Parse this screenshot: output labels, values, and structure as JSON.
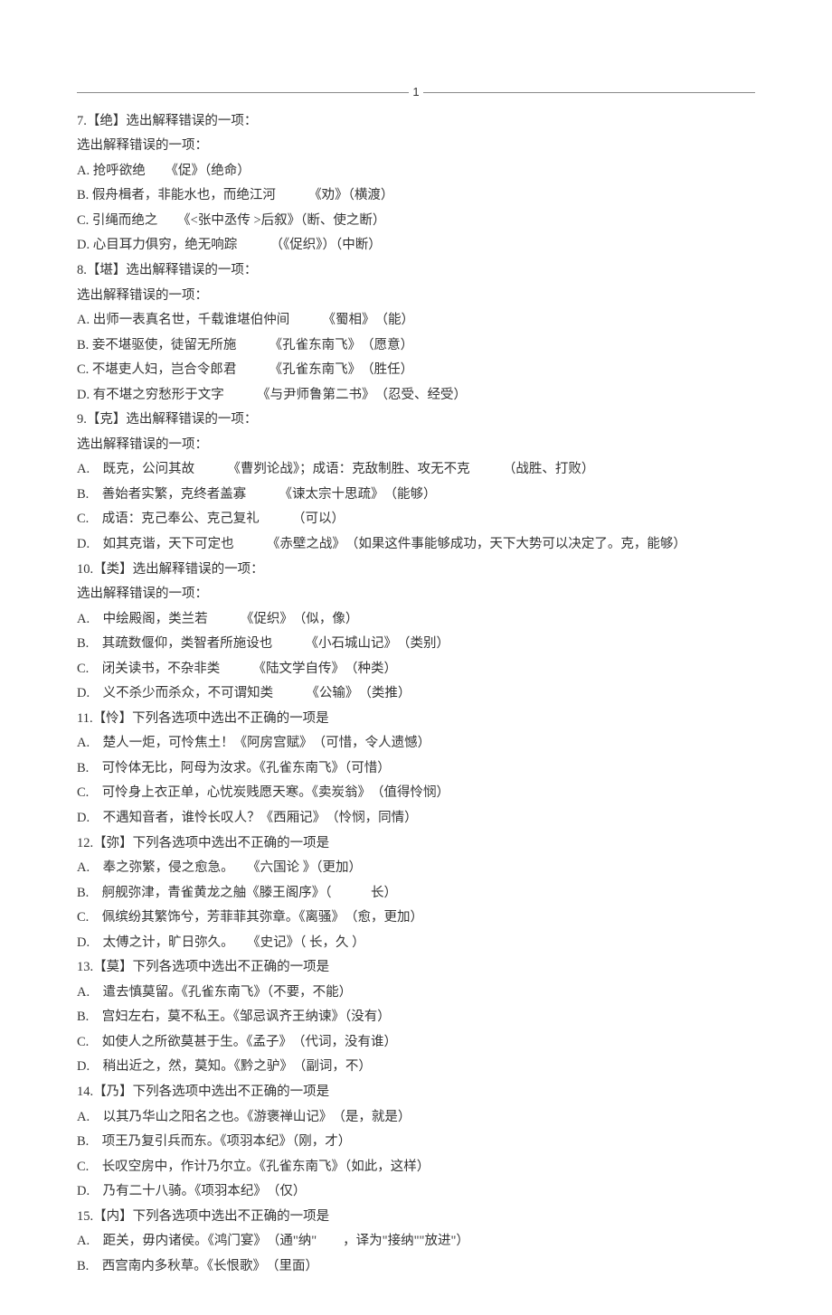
{
  "page_number": "1",
  "questions": [
    {
      "header": "7.【绝】选出解释错误的一项：",
      "prompt": "选出解释错误的一项：",
      "opts": [
        "A. 抢呼欲绝　　《促》（绝命）",
        "B. 假舟楫者，非能水也，而绝江河　　　《劝》（横渡）",
        "C. 引绳而绝之　　《<张中丞传 >后叙》（断、使之断）",
        "D. 心目耳力俱穷，绝无响踪　　　（《促织》）（中断）"
      ]
    },
    {
      "header": "8.【堪】选出解释错误的一项：",
      "prompt": "选出解释错误的一项：",
      "opts": [
        "A. 出师一表真名世，千载谁堪伯仲间　　　《蜀相》　（能）",
        "B. 妾不堪驱使，徒留无所施　　　《孔雀东南飞》　（愿意）",
        "C. 不堪吏人妇，岂合令郎君　　　《孔雀东南飞》　（胜任）",
        "D. 有不堪之穷愁形于文字　　　《与尹师鲁第二书》　（忍受、经受）"
      ]
    },
    {
      "header": "9.【克】选出解释错误的一项：",
      "prompt": "选出解释错误的一项：",
      "opts": [
        "A.　既克，公问其故　　　《曹刿论战》；成语：克敌制胜、攻无不克　　　（战胜、打败）",
        "B.　善始者实繁，克终者盖寡　　　《谏太宗十思疏》　（能够）",
        "C.　成语：克己奉公、克己复礼　　　（可以）",
        "D.　如其克谐，天下可定也　　　《赤壁之战》　（如果这件事能够成功，天下大势可以决定了。克，能够）"
      ]
    },
    {
      "header": "10.【类】选出解释错误的一项：",
      "prompt": "选出解释错误的一项：",
      "opts": [
        "A.　中绘殿阁，类兰若　　　《促织》　（似，像）",
        "B.　其疏数偃仰，类智者所施设也　　　《小石城山记》　（类别）",
        "C.　闭关读书，不杂非类　　　《陆文学自传》　（种类）",
        "D.　义不杀少而杀众，不可谓知类　　　《公输》　（类推）"
      ]
    },
    {
      "header": "11.【怜】下列各选项中选出不正确的一项是",
      "prompt": null,
      "opts": [
        "A.　楚人一炬，可怜焦土！《阿房宫赋》　（可惜，令人遗憾）",
        "B.　可怜体无比，阿母为汝求。《孔雀东南飞》（可惜）",
        "C.　可怜身上衣正单，心忧炭贱愿天寒。《卖炭翁》　（值得怜悯）",
        "D.　不遇知音者，谁怜长叹人？《西厢记》　（怜悯，同情）"
      ]
    },
    {
      "header": "12.【弥】下列各选项中选出不正确的一项是",
      "prompt": null,
      "opts": [
        "A.　奉之弥繁，侵之愈急。　　《六国论 》（更加）",
        "B.　舸舰弥津，青雀黄龙之舳《滕王阁序》（　　　长）",
        "C.　佩缤纷其繁饰兮，芳菲菲其弥章。《离骚》　（愈，更加）",
        "D.　太傅之计，旷日弥久。　　《史记》（ 长，久 ）"
      ]
    },
    {
      "header": "13.【莫】下列各选项中选出不正确的一项是",
      "prompt": null,
      "opts": [
        "A.　遣去慎莫留。《孔雀东南飞》（不要，不能）",
        "B.　宫妇左右，莫不私王。《邹忌讽齐王纳谏》（没有）",
        "C.　如使人之所欲莫甚于生。《孟子》　（代词，没有谁）",
        "D.　稍出近之，然，莫知。《黔之驴》　（副词，不）"
      ]
    },
    {
      "header": "14.【乃】下列各选项中选出不正确的一项是",
      "prompt": null,
      "opts": [
        "A.　以其乃华山之阳名之也。《游褒禅山记》　（是，就是）",
        "B.　项王乃复引兵而东。《项羽本纪》（刚，才）",
        "C.　长叹空房中，作计乃尔立。《孔雀东南飞》（如此，这样）",
        "D.　乃有二十八骑。《项羽本纪》　（仅）"
      ]
    },
    {
      "header": "15.【内】下列各选项中选出不正确的一项是",
      "prompt": null,
      "opts": [
        "A.　距关，毋内诸侯。《鸿门宴》　（通\"纳\"　　，译为\"接纳\"\"放进\"）",
        "B.　西宫南内多秋草。《长恨歌》　（里面）"
      ]
    }
  ]
}
